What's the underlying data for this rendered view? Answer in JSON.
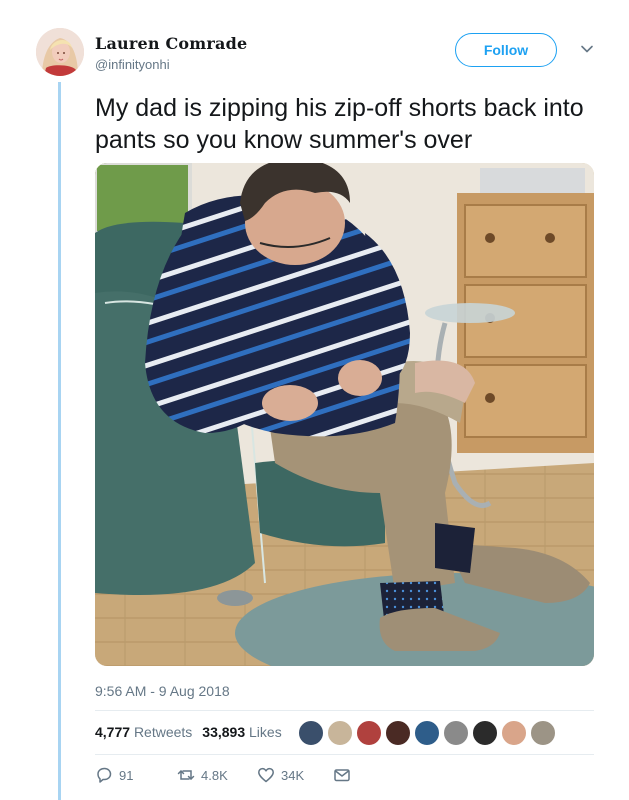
{
  "author": {
    "display_name": "Lauren Comrade",
    "handle": "@infinityonhi"
  },
  "header": {
    "follow_label": "Follow",
    "caret_icon": "chevron-down-icon"
  },
  "tweet": {
    "text": "My dad is zipping his zip-off shorts back into pants so you know summer's over",
    "timestamp": "9:56 AM - 9 Aug 2018"
  },
  "stats": {
    "retweets_count": "4,777",
    "retweets_label": "Retweets",
    "likes_count": "33,893",
    "likes_label": "Likes"
  },
  "actions": {
    "reply_count": "91",
    "retweet_count": "4.8K",
    "like_count": "34K"
  },
  "colors": {
    "accent": "#1da1f2",
    "thread_line": "#a8d4f2",
    "muted_text": "#657786"
  }
}
